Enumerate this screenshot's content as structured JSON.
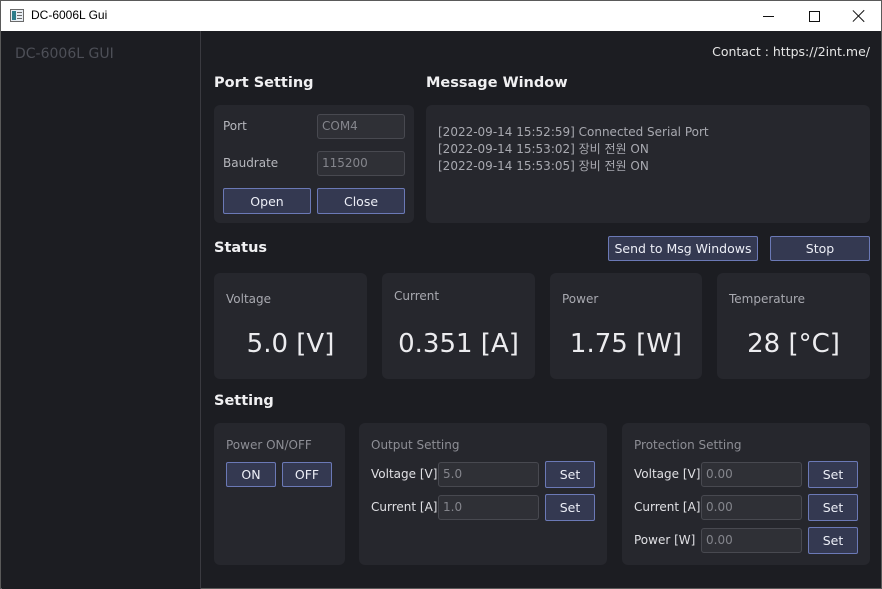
{
  "window": {
    "title": "DC-6006L Gui",
    "controls": {
      "minimize": "minimize-icon",
      "maximize": "maximize-icon",
      "close": "close-icon"
    }
  },
  "sidebar": {
    "brand": "DC-6006L GUI"
  },
  "header": {
    "contact": "Contact : https://2int.me/"
  },
  "port_setting": {
    "title": "Port Setting",
    "port_label": "Port",
    "port_value": "COM4",
    "baudrate_label": "Baudrate",
    "baudrate_value": "115200",
    "open_label": "Open",
    "close_label": "Close"
  },
  "message_window": {
    "title": "Message Window",
    "lines": [
      "[2022-09-14 15:52:59] Connected Serial Port",
      "[2022-09-14 15:53:02] 장비 전원 ON",
      "[2022-09-14 15:53:05] 장비 전원 ON"
    ]
  },
  "status": {
    "title": "Status",
    "send_label": "Send to Msg Windows",
    "stop_label": "Stop",
    "cards": [
      {
        "name": "Voltage",
        "value": "5.0 [V]"
      },
      {
        "name": "Current",
        "value": "0.351 [A]"
      },
      {
        "name": "Power",
        "value": "1.75 [W]"
      },
      {
        "name": "Temperature",
        "value": "28 [°C]"
      }
    ]
  },
  "setting": {
    "title": "Setting",
    "power": {
      "title": "Power ON/OFF",
      "on_label": "ON",
      "off_label": "OFF"
    },
    "output": {
      "title": "Output Setting",
      "voltage_label": "Voltage [V]",
      "voltage_placeholder": "5.0",
      "current_label": "Current [A]",
      "current_placeholder": "1.0",
      "set_label": "Set"
    },
    "protection": {
      "title": "Protection Setting",
      "voltage_label": "Voltage [V]",
      "voltage_placeholder": "0.00",
      "current_label": "Current [A]",
      "current_placeholder": "0.00",
      "power_label": "Power [W]",
      "power_placeholder": "0.00",
      "set_label": "Set"
    }
  }
}
